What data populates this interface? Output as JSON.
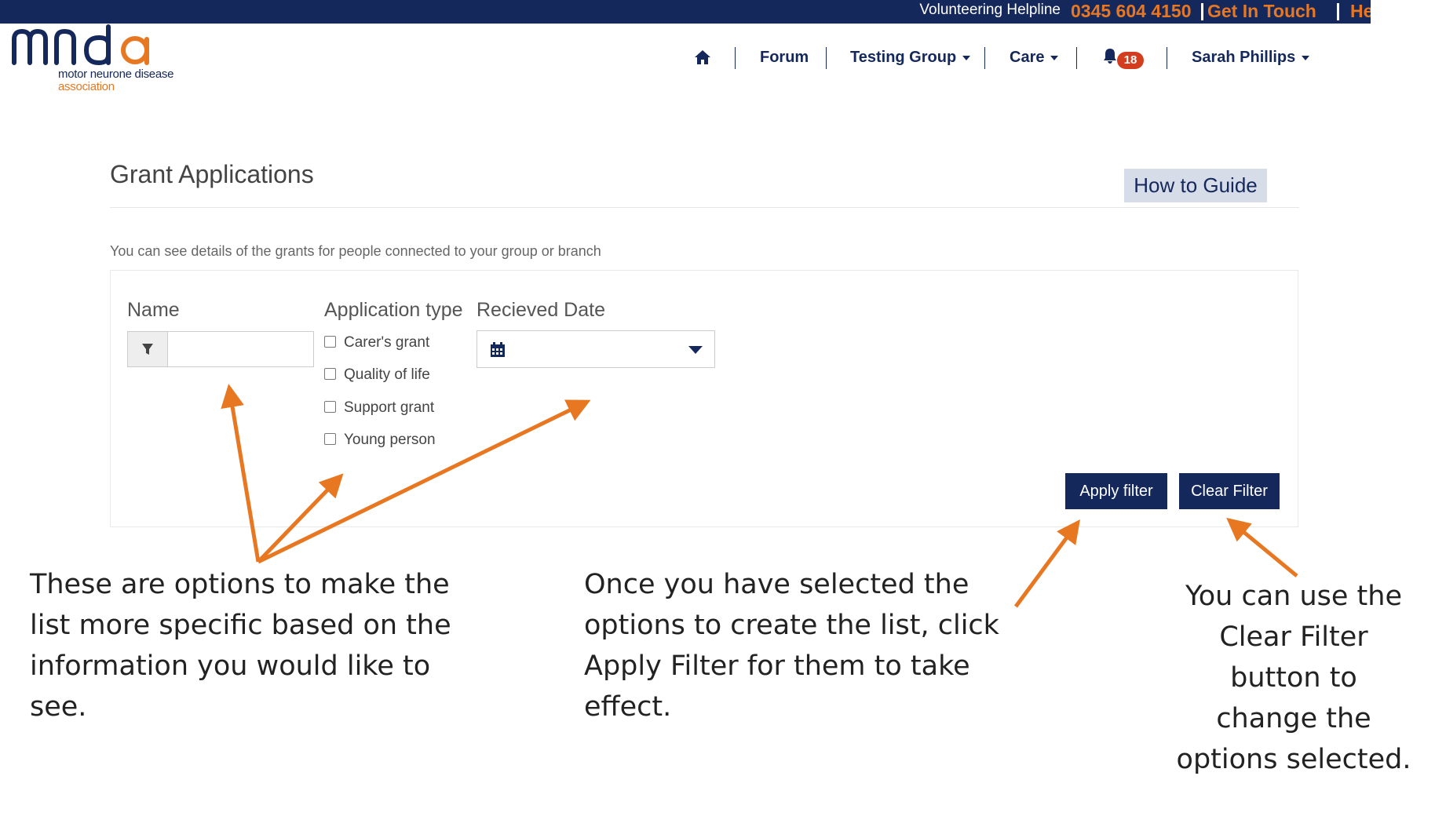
{
  "topbar": {
    "helpline_label": "Volunteering Helpline",
    "phone": "0345 604 4150",
    "get_in_touch": "Get In Touch",
    "help_fragment": "He"
  },
  "logo": {
    "wordmark": "mnd a",
    "tagline_line1": "motor neurone disease",
    "tagline_line2": "association"
  },
  "nav": {
    "home_icon": "home-icon",
    "forum": "Forum",
    "testing_group": "Testing Group",
    "care": "Care",
    "bell_icon": "bell-icon",
    "notifications_count": "18",
    "user": "Sarah Phillips"
  },
  "page": {
    "title": "Grant Applications",
    "how_to_guide": "How to Guide",
    "subtitle": "You can see details of the grants for people connected to your group or branch"
  },
  "filters": {
    "name_label": "Name",
    "name_value": "",
    "name_placeholder": "",
    "filter_icon": "filter-icon",
    "application_type_label": "Application type",
    "application_types": [
      "Carer's grant",
      "Quality of life",
      "Support grant",
      "Young person"
    ],
    "received_date_label": "Recieved Date",
    "calendar_icon": "calendar-icon",
    "date_value": "",
    "apply_button": "Apply filter",
    "clear_button": "Clear Filter"
  },
  "annotations": {
    "left": "These are options to make the list more specific based on the information you would like to see.",
    "middle": "Once you have selected the options to create the list, click Apply Filter for them to take effect.",
    "right": "You can use the Clear Filter button to change the options selected."
  },
  "colors": {
    "brand_navy": "#15285c",
    "brand_orange": "#e87722",
    "annotation_arrow": "#e87722",
    "badge_red": "#d33d1e"
  }
}
